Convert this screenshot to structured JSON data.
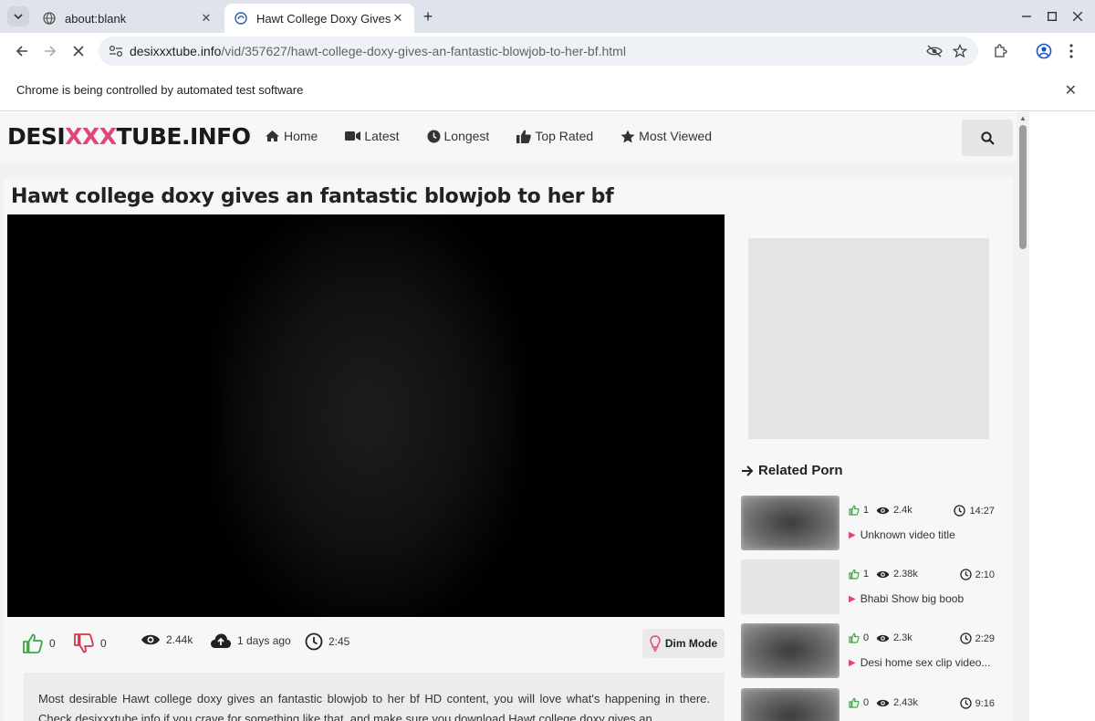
{
  "browser": {
    "tabs": [
      {
        "title": "about:blank",
        "active": false
      },
      {
        "title": "Hawt College Doxy Gives",
        "active": true
      }
    ],
    "url_host": "desixxxtube.info",
    "url_path": "/vid/357627/hawt-college-doxy-gives-an-fantastic-blowjob-to-her-bf.html",
    "infobar_message": "Chrome is being controlled by automated test software"
  },
  "site": {
    "logo_part1": "DESI",
    "logo_part2": "XXX",
    "logo_part3": "TUBE.INFO",
    "accent_color": "#e0457b",
    "nav": [
      {
        "label": "Home",
        "icon": "home-icon"
      },
      {
        "label": "Latest",
        "icon": "video-camera-icon"
      },
      {
        "label": "Longest",
        "icon": "clock-icon"
      },
      {
        "label": "Top Rated",
        "icon": "thumbs-up-icon"
      },
      {
        "label": "Most Viewed",
        "icon": "star-icon"
      }
    ]
  },
  "video": {
    "title": "Hawt college doxy gives an fantastic blowjob to her bf",
    "likes": "0",
    "dislikes": "0",
    "views": "2.44k",
    "uploaded": "1 days ago",
    "duration": "2:45",
    "dim_mode_label": "Dim Mode",
    "description": "Most desirable Hawt college doxy gives an fantastic blowjob to her bf HD content, you will love what's happening in there. Check desixxxtube.info if you crave for something like that, and make sure you download Hawt college doxy gives an"
  },
  "related": {
    "heading": "Related Porn",
    "items": [
      {
        "likes": "1",
        "views": "2.4k",
        "duration": "14:27",
        "title": "Unknown video title"
      },
      {
        "likes": "1",
        "views": "2.38k",
        "duration": "2:10",
        "title": "Bhabi Show big boob"
      },
      {
        "likes": "0",
        "views": "2.3k",
        "duration": "2:29",
        "title": "Desi home sex clip video..."
      },
      {
        "likes": "0",
        "views": "2.43k",
        "duration": "9:16",
        "title": ""
      }
    ]
  }
}
